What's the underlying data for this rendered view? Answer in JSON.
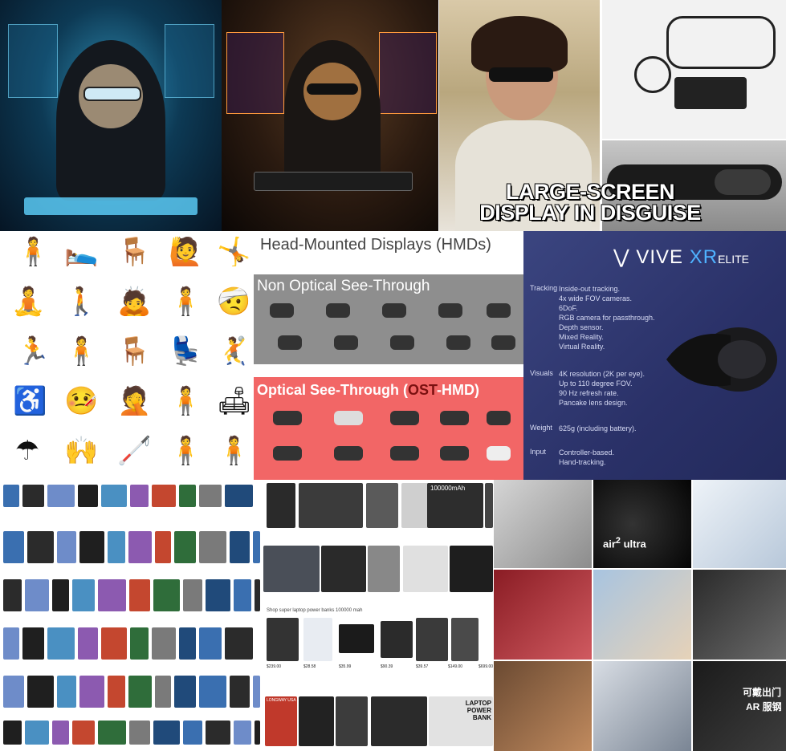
{
  "banner": {
    "line1": "LARGE-SCREEN",
    "line2": "DISPLAY IN DISGUISE"
  },
  "hmd": {
    "title": "Head-Mounted Displays (HMDs)",
    "non_optical": "Non Optical See-Through",
    "optical_prefix": "Optical See-Through (",
    "optical_acr": "OST",
    "optical_suffix": "-HMD)"
  },
  "vive": {
    "brand": "VIVE",
    "model": "XR",
    "sub": "ELITE",
    "rows": [
      {
        "label": "Tracking",
        "text": "Inside-out tracking.\n4x wide FOV cameras.\n6DoF.\nRGB camera for passthrough.\nDepth sensor.\nMixed Reality.\nVirtual Reality."
      },
      {
        "label": "Visuals",
        "text": "4K resolution (2K per eye).\nUp to 110 degree FOV.\n90 Hz refresh rate.\nPancake lens design."
      },
      {
        "label": "Weight",
        "text": "625g (including battery)."
      },
      {
        "label": "Input",
        "text": "Controller-based.\nHand-tracking."
      }
    ]
  },
  "shop": {
    "bar": "Shop super laptop power banks 100000 mah",
    "banner_text": "100000mAh",
    "laptop_label": "LAPTOP POWER BANK",
    "brand_label": "LONGWAY USA",
    "prices": [
      "$239.00",
      "$28.58",
      "$35.99",
      "$90.39",
      "$39.57",
      "$149.00",
      "$699.00"
    ]
  },
  "collage": {
    "air_brand": "air",
    "air_sup": "2",
    "air_suffix": "ultra",
    "cn_line1": "可戴出门",
    "cn_line2": "AR 服钢"
  },
  "colors": {
    "vive_bg": "#2a3168",
    "red_band": "#f26666",
    "grey_band": "#8e8e8e"
  }
}
